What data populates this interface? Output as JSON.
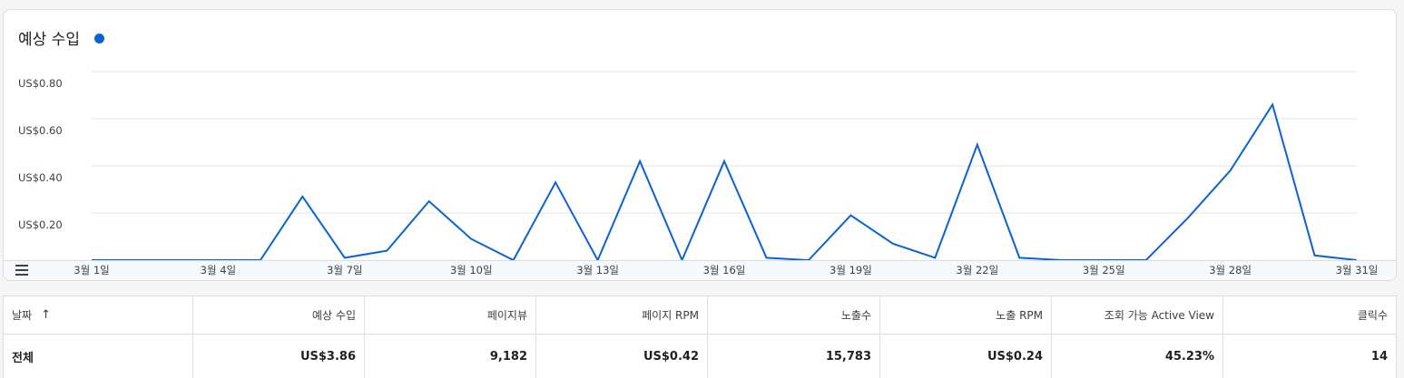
{
  "chart_data": {
    "type": "line",
    "title": "예상 수입",
    "series_color": "#0b63d1",
    "ylim": [
      0,
      0.8
    ],
    "y_ticks": [
      0.2,
      0.4,
      0.6,
      0.8
    ],
    "y_tick_labels": [
      "US$0.20",
      "US$0.40",
      "US$0.60",
      "US$0.80"
    ],
    "x_tick_labels": [
      {
        "day": 1,
        "label": "3월 1일"
      },
      {
        "day": 4,
        "label": "3월 4일"
      },
      {
        "day": 7,
        "label": "3월 7일"
      },
      {
        "day": 10,
        "label": "3월 10일"
      },
      {
        "day": 13,
        "label": "3월 13일"
      },
      {
        "day": 16,
        "label": "3월 16일"
      },
      {
        "day": 19,
        "label": "3월 19일"
      },
      {
        "day": 22,
        "label": "3월 22일"
      },
      {
        "day": 25,
        "label": "3월 25일"
      },
      {
        "day": 28,
        "label": "3월 28일"
      },
      {
        "day": 31,
        "label": "3월 31일"
      }
    ],
    "grid": true,
    "x": [
      1,
      2,
      3,
      4,
      5,
      6,
      7,
      8,
      9,
      10,
      11,
      12,
      13,
      14,
      15,
      16,
      17,
      18,
      19,
      20,
      21,
      22,
      23,
      24,
      25,
      26,
      27,
      28,
      29,
      30,
      31
    ],
    "values": [
      0,
      0,
      0,
      0,
      0,
      0.27,
      0.01,
      0.04,
      0.25,
      0.09,
      0,
      0.33,
      0,
      0.42,
      0,
      0.42,
      0.01,
      0,
      0.19,
      0.07,
      0.01,
      0.49,
      0.01,
      0,
      0,
      0,
      0.18,
      0.38,
      0.66,
      0.02,
      0
    ]
  },
  "table": {
    "headers": [
      "날짜",
      "예상 수입",
      "페이지뷰",
      "페이지 RPM",
      "노출수",
      "노출 RPM",
      "조회 가능 Active View",
      "클릭수"
    ],
    "sort_icon": "arrow-up-icon",
    "sort_glyph": "↑",
    "total": [
      "전체",
      "US$3.86",
      "9,182",
      "US$0.42",
      "15,783",
      "US$0.24",
      "45.23%",
      "14"
    ]
  }
}
